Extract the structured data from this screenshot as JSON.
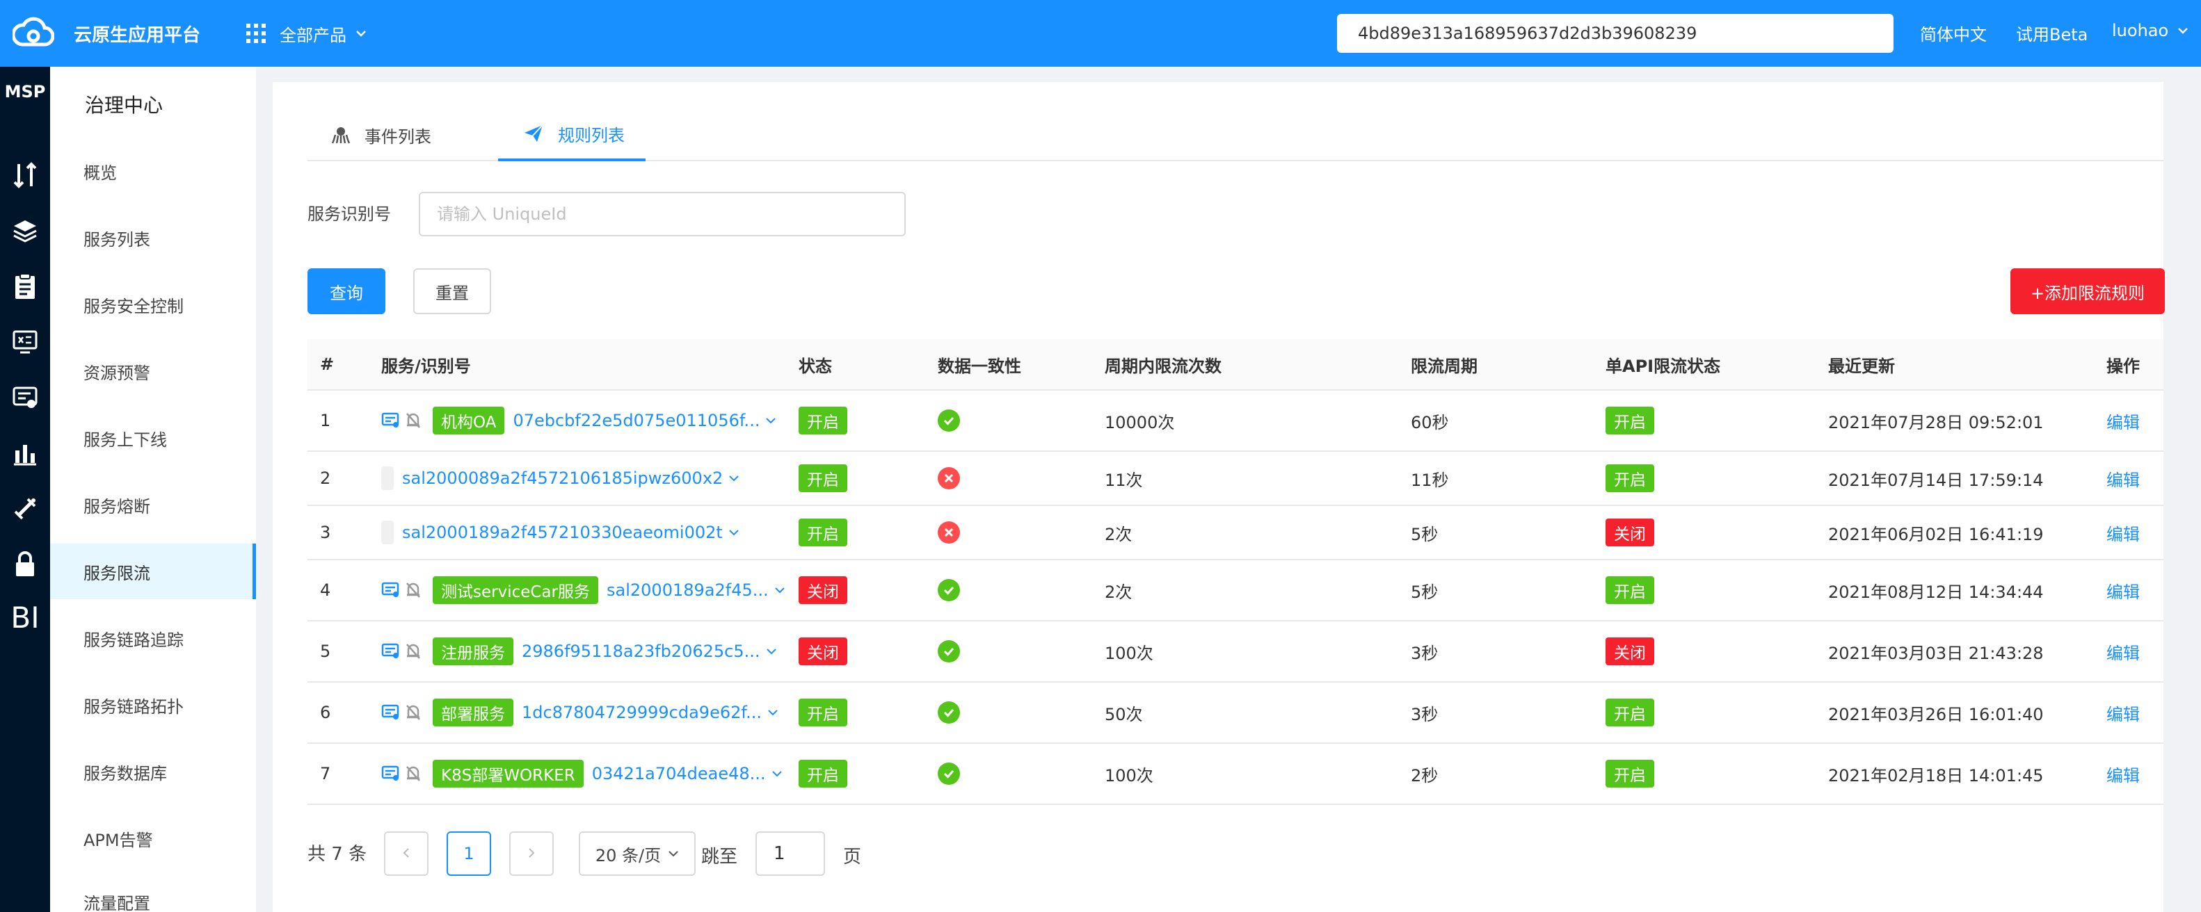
{
  "header": {
    "platform_name": "云原生应用平台",
    "all_products": "全部产品",
    "search_value": "4bd89e313a168959637d2d3b39608239",
    "lang": "简体中文",
    "beta": "试用Beta",
    "user": "luohao"
  },
  "rail": {
    "msp": "MSP",
    "bi": "BI"
  },
  "sidebar": {
    "title": "治理中心",
    "items": [
      {
        "label": "概览"
      },
      {
        "label": "服务列表"
      },
      {
        "label": "服务安全控制"
      },
      {
        "label": "资源预警"
      },
      {
        "label": "服务上下线"
      },
      {
        "label": "服务熔断"
      },
      {
        "label": "服务限流"
      },
      {
        "label": "服务链路追踪"
      },
      {
        "label": "服务链路拓扑"
      },
      {
        "label": "服务数据库"
      },
      {
        "label": "APM告警"
      },
      {
        "label": "流量配置"
      }
    ],
    "active": "服务限流"
  },
  "tabs": [
    {
      "label": "事件列表"
    },
    {
      "label": "规则列表"
    }
  ],
  "filter": {
    "label": "服务识别号",
    "placeholder": "请输入 UniqueId",
    "query": "查询",
    "reset": "重置",
    "add": "+添加限流规则"
  },
  "table": {
    "headers": [
      "#",
      "服务/识别号",
      "状态",
      "数据一致性",
      "周期内限流次数",
      "限流周期",
      "单API限流状态",
      "最近更新",
      "操作"
    ],
    "rows": [
      {
        "no": "1",
        "service_name": "机构OA",
        "id": "07ebcbf22e5d075e011056f...",
        "status": "开启",
        "consistent": true,
        "count": "10000次",
        "period": "60秒",
        "api_status": "开启",
        "updated": "2021年07月28日 09:52:01",
        "action": "编辑"
      },
      {
        "no": "2",
        "service_name": "",
        "id": "sal2000089a2f4572106185ipwz600x2",
        "status": "开启",
        "consistent": false,
        "count": "11次",
        "period": "11秒",
        "api_status": "开启",
        "updated": "2021年07月14日 17:59:14",
        "action": "编辑"
      },
      {
        "no": "3",
        "service_name": "",
        "id": "sal2000189a2f457210330eaeomi002t",
        "status": "开启",
        "consistent": false,
        "count": "2次",
        "period": "5秒",
        "api_status": "关闭",
        "updated": "2021年06月02日 16:41:19",
        "action": "编辑"
      },
      {
        "no": "4",
        "service_name": "测试serviceCar服务",
        "id": "sal2000189a2f45...",
        "status": "关闭",
        "consistent": true,
        "count": "2次",
        "period": "5秒",
        "api_status": "开启",
        "updated": "2021年08月12日 14:34:44",
        "action": "编辑"
      },
      {
        "no": "5",
        "service_name": "注册服务",
        "id": "2986f95118a23fb20625c5...",
        "status": "关闭",
        "consistent": true,
        "count": "100次",
        "period": "3秒",
        "api_status": "关闭",
        "updated": "2021年03月03日 21:43:28",
        "action": "编辑"
      },
      {
        "no": "6",
        "service_name": "部署服务",
        "id": "1dc87804729999cda9e62f...",
        "status": "开启",
        "consistent": true,
        "count": "50次",
        "period": "3秒",
        "api_status": "开启",
        "updated": "2021年03月26日 16:01:40",
        "action": "编辑"
      },
      {
        "no": "7",
        "service_name": "K8S部署WORKER",
        "id": "03421a704deae48...",
        "status": "开启",
        "consistent": true,
        "count": "100次",
        "period": "2秒",
        "api_status": "开启",
        "updated": "2021年02月18日 14:01:45",
        "action": "编辑"
      }
    ]
  },
  "pagination": {
    "total": "共 7 条",
    "current": "1",
    "page_size": "20 条/页",
    "jump_label": "跳至",
    "jump_value": "1",
    "page_suffix": "页"
  },
  "colors": {
    "primary": "#1890ff",
    "success": "#52c41a",
    "danger": "#f5222d",
    "sidebar_dark": "#001529"
  }
}
